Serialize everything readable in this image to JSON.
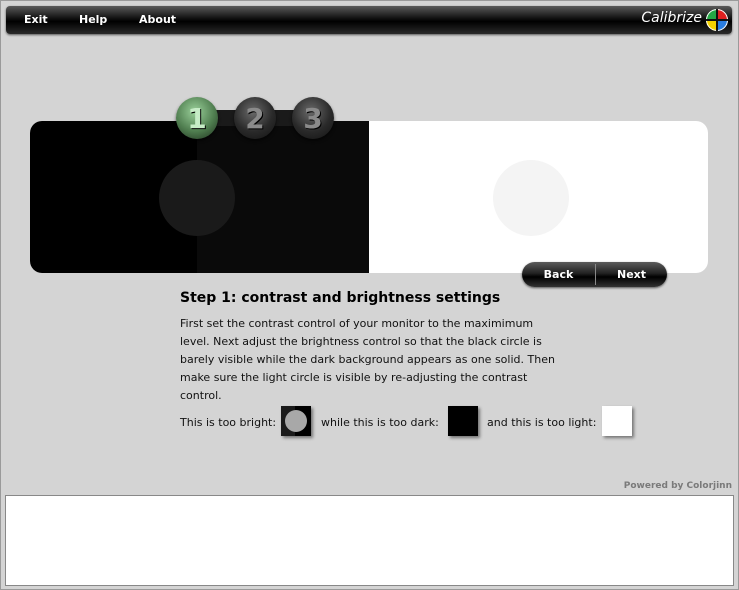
{
  "menu": {
    "items": [
      {
        "label": "Exit"
      },
      {
        "label": "Help"
      },
      {
        "label": "About"
      }
    ],
    "brand": "Calibrize",
    "brand_logo_icon": "calibrize-color-wheel-icon"
  },
  "steps": [
    {
      "number": "1",
      "active": true
    },
    {
      "number": "2",
      "active": false
    },
    {
      "number": "3",
      "active": false
    }
  ],
  "nav": {
    "back_label": "Back",
    "next_label": "Next"
  },
  "content": {
    "title": "Step 1: contrast and brightness settings",
    "body": "First set the contrast control of your monitor to the maximimum level. Next adjust the brightness control so that the black circle is barely visible while the dark background appears as one solid. Then make sure the light circle is visible by re-adjusting the contrast control.",
    "examples": {
      "too_bright": "This is too bright:",
      "too_dark": "while this is too dark:",
      "too_light": "and this is too light:"
    }
  },
  "footer": {
    "powered_by": "Powered by Colorjinn"
  },
  "colors": {
    "background": "#d4d4d4",
    "active_step": "#5e8f5e",
    "menubar": "#000000"
  }
}
